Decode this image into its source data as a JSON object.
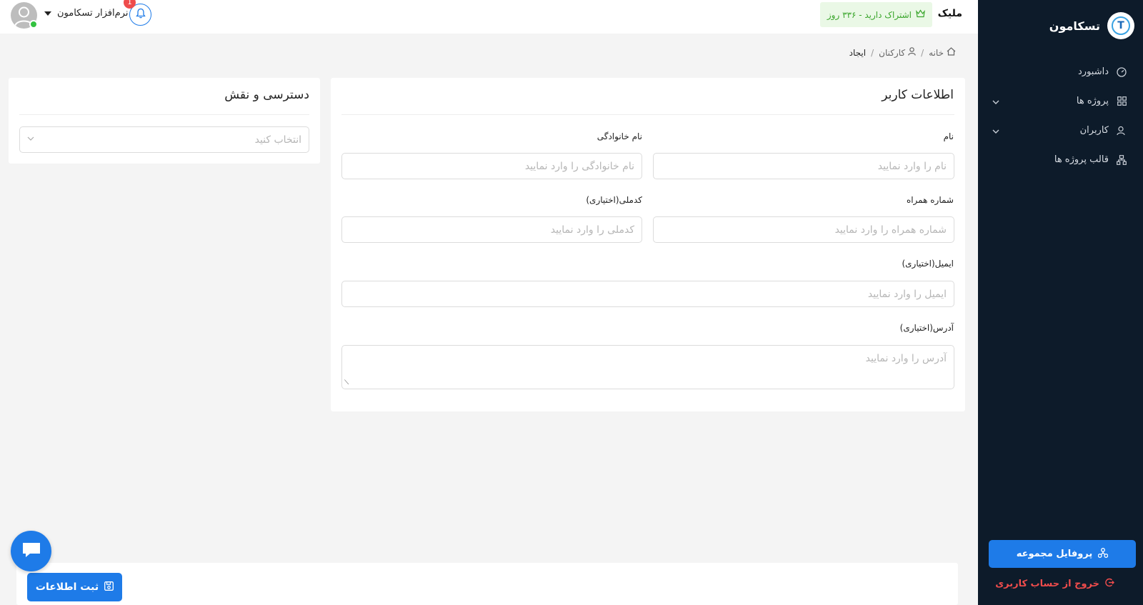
{
  "sidebar": {
    "brand_name": "تسکامون",
    "brand_logo_letter": "T",
    "items": [
      {
        "label": "داشبورد",
        "icon": "dashboard-icon",
        "has_chevron": false
      },
      {
        "label": "پروژه ها",
        "icon": "grid-icon",
        "has_chevron": true
      },
      {
        "label": "کاربران",
        "icon": "users-icon",
        "has_chevron": true
      },
      {
        "label": "قالب پروژه ها",
        "icon": "sitemap-icon",
        "has_chevron": false
      }
    ],
    "profile_button": "پروفایل مجموعه",
    "logout": "خروج از حساب کاربری"
  },
  "header": {
    "title": "ملیک",
    "subscription": "اشتراک دارید - ۳۳۶ روز",
    "user_name": "نرم‌افزار تسکامون",
    "notification_count": "1"
  },
  "breadcrumb": {
    "home": "خانه",
    "staff": "کارکنان",
    "current": "ایجاد"
  },
  "user_card": {
    "title": "اطلاعات کاربر",
    "first_name_label": "نام",
    "first_name_placeholder": "نام را وارد نمایید",
    "last_name_label": "نام خانوادگی",
    "last_name_placeholder": "نام خانوادگی را وارد نمایید",
    "mobile_label": "شماره همراه",
    "mobile_placeholder": "شماره همراه را وارد نمایید",
    "national_code_label": "کدملی(اختیاری)",
    "national_code_placeholder": "کدملی را وارد نمایید",
    "email_label": "ایمیل(اختیاری)",
    "email_placeholder": "ایمیل را وارد نمایید",
    "address_label": "آدرس(اختیاری)",
    "address_placeholder": "آدرس را وارد نمایید"
  },
  "access_card": {
    "title": "دسترسی و نقش",
    "select_placeholder": "انتخاب کنید"
  },
  "save_button": "ثبت اطلاعات",
  "colors": {
    "primary": "#1e7be8",
    "sidebar_bg": "#0d1b2a",
    "danger": "#ef4c4c",
    "success": "#3aa62c"
  }
}
